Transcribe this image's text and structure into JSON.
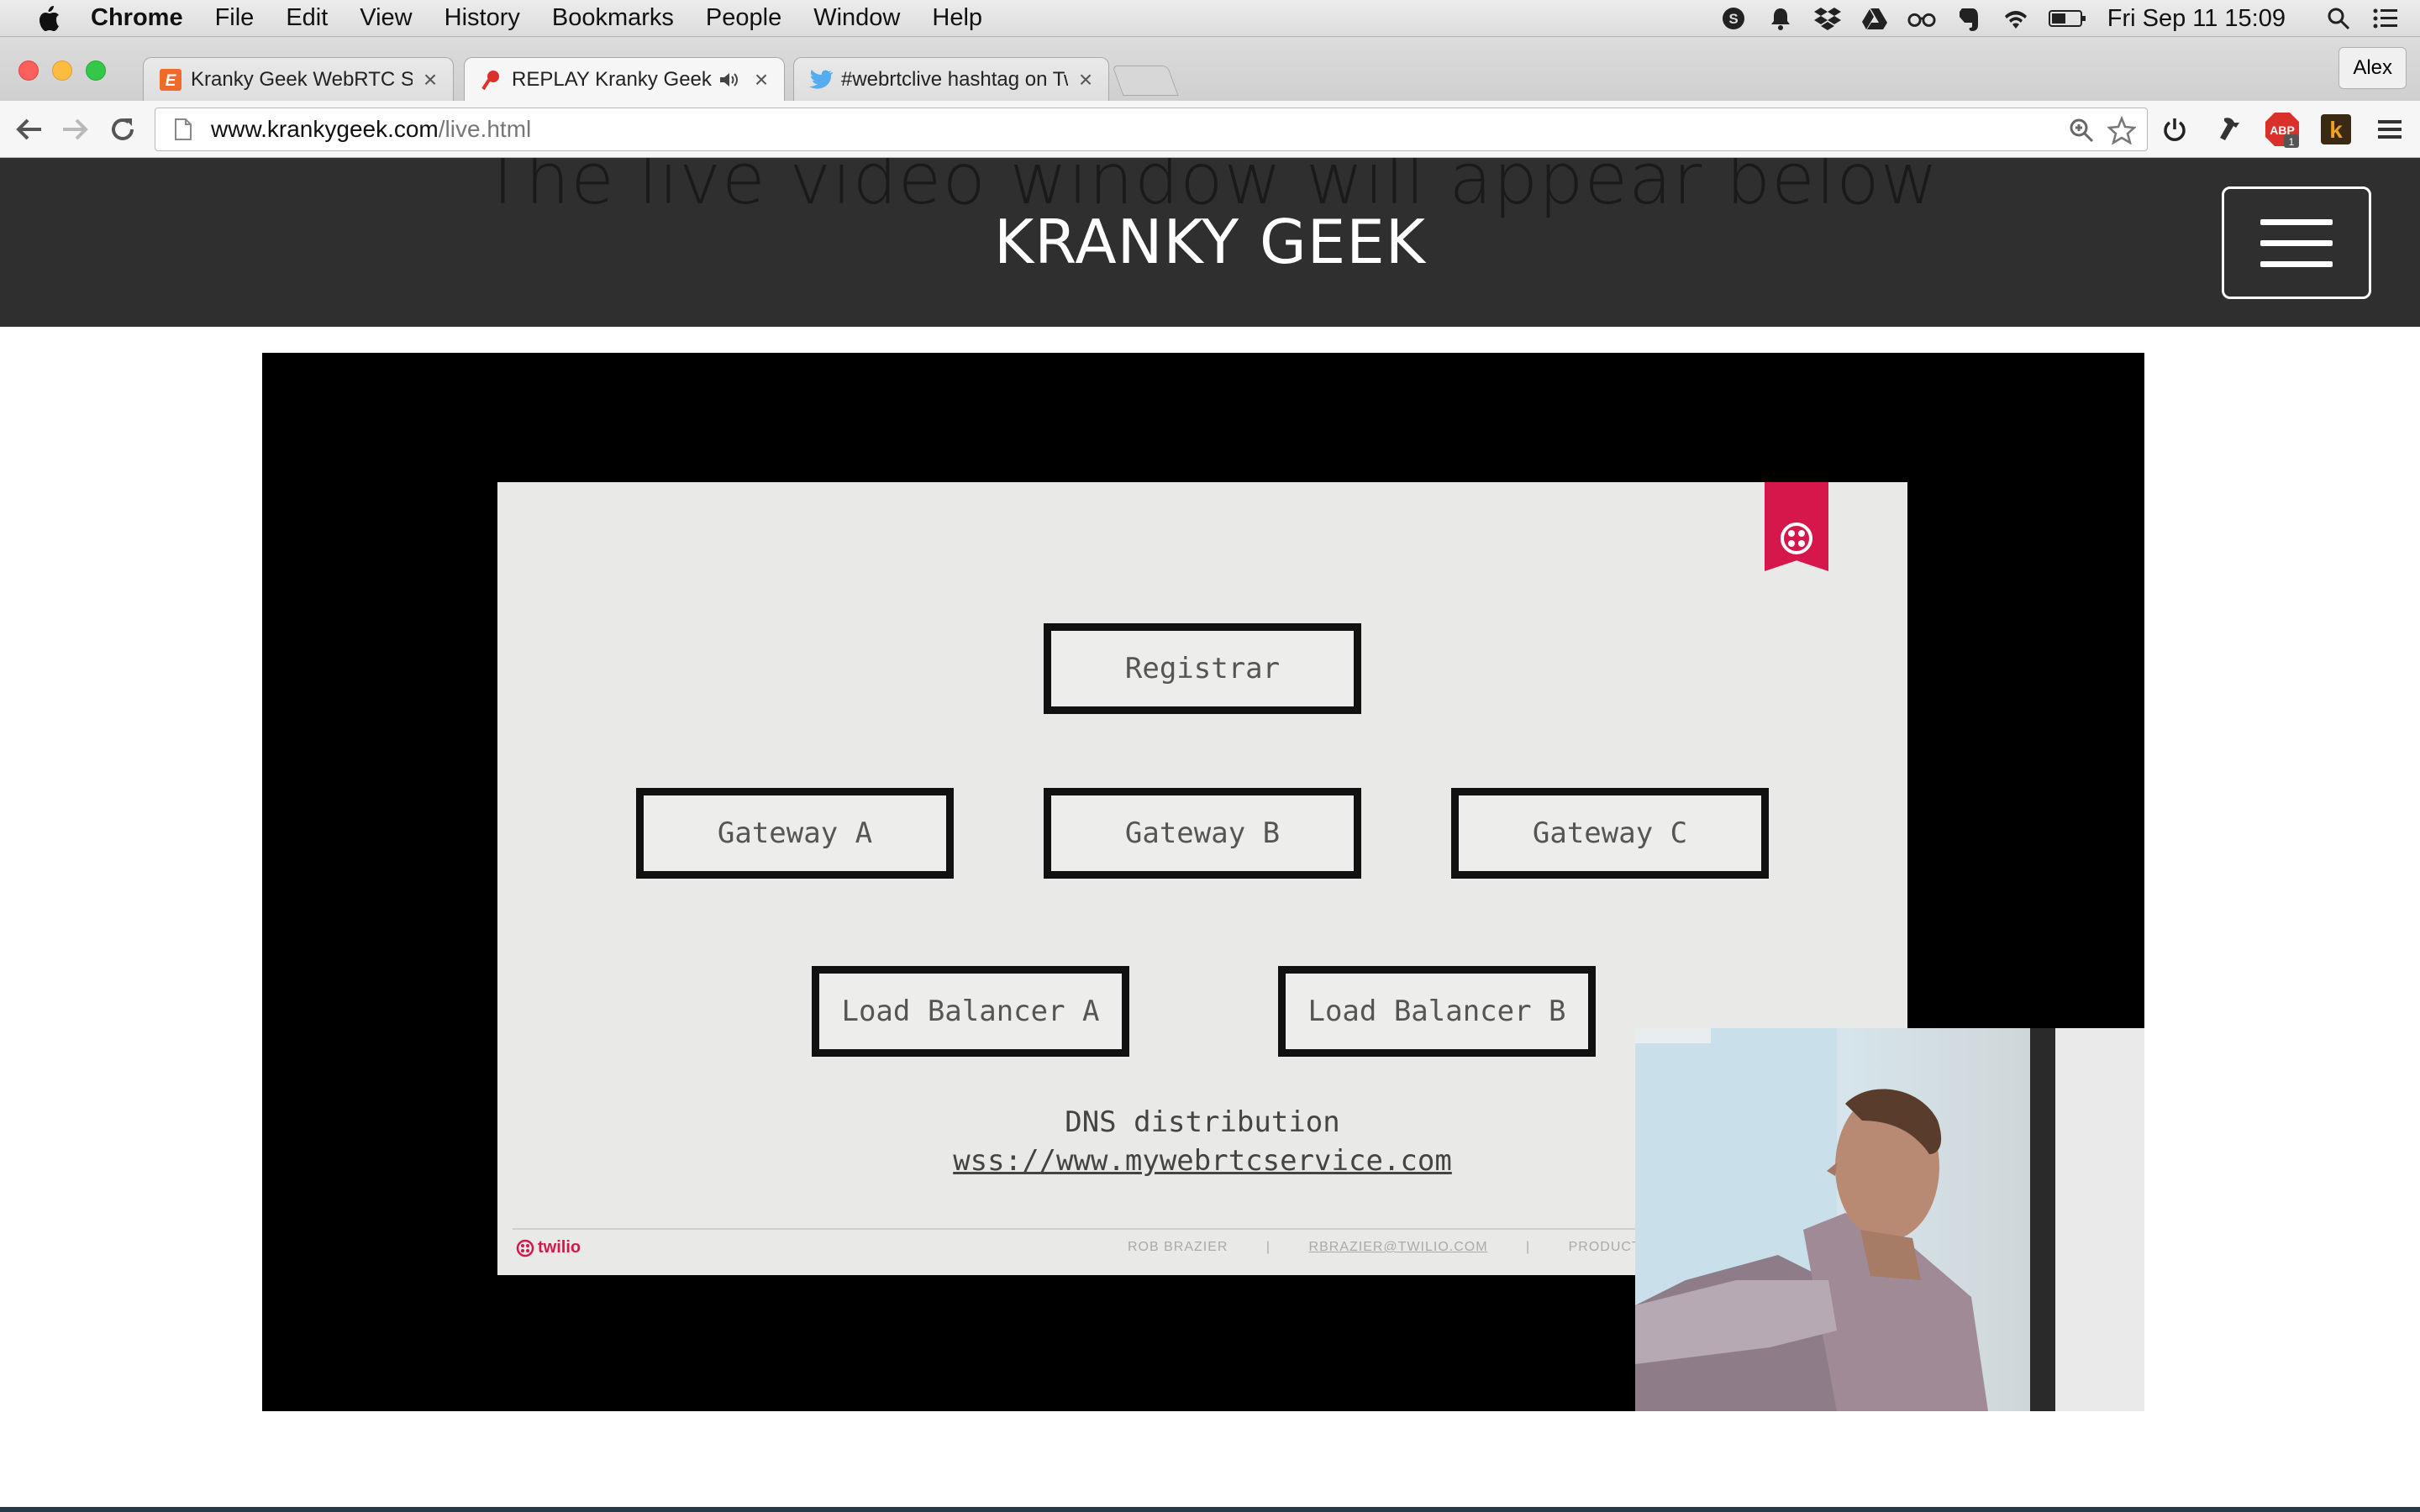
{
  "menubar": {
    "app_name": "Chrome",
    "menus": [
      "File",
      "Edit",
      "View",
      "History",
      "Bookmarks",
      "People",
      "Window",
      "Help"
    ],
    "clock": "Fri Sep 11  15:09"
  },
  "tabs": [
    {
      "title": "Kranky Geek WebRTC Show",
      "favicon": "e-icon"
    },
    {
      "title": "REPLAY Kranky Geek",
      "favicon": "pin-icon",
      "audio": true
    },
    {
      "title": "#webrtclive hashtag on Twitt",
      "favicon": "twitter-bird-icon"
    }
  ],
  "profile": {
    "name": "Alex"
  },
  "omnibox": {
    "host": "www.krankygeek.com",
    "path": "/live.html"
  },
  "extensions": {
    "abp_label": "ABP",
    "abp_badge": "1",
    "k_label": "k"
  },
  "site": {
    "ghost_text": "The live video window will appear below",
    "title": "KRANKY GEEK"
  },
  "slide": {
    "nodes": {
      "registrar": "Registrar",
      "gateway_a": "Gateway A",
      "gateway_b": "Gateway B",
      "gateway_c": "Gateway C",
      "lb_a": "Load Balancer A",
      "lb_b": "Load Balancer B"
    },
    "dns_label": "DNS distribution",
    "dns_url": "wss://www.mywebrtcservice.com",
    "brand": "twilio",
    "footer": [
      "ROB BRAZIER",
      "|",
      "RBRAZIER@TWILIO.COM",
      "|",
      "PRODUCT MANAGER, SDKS",
      "|"
    ]
  },
  "colors": {
    "brand_red": "#d6174b",
    "header_bg": "#2f2f2f"
  }
}
